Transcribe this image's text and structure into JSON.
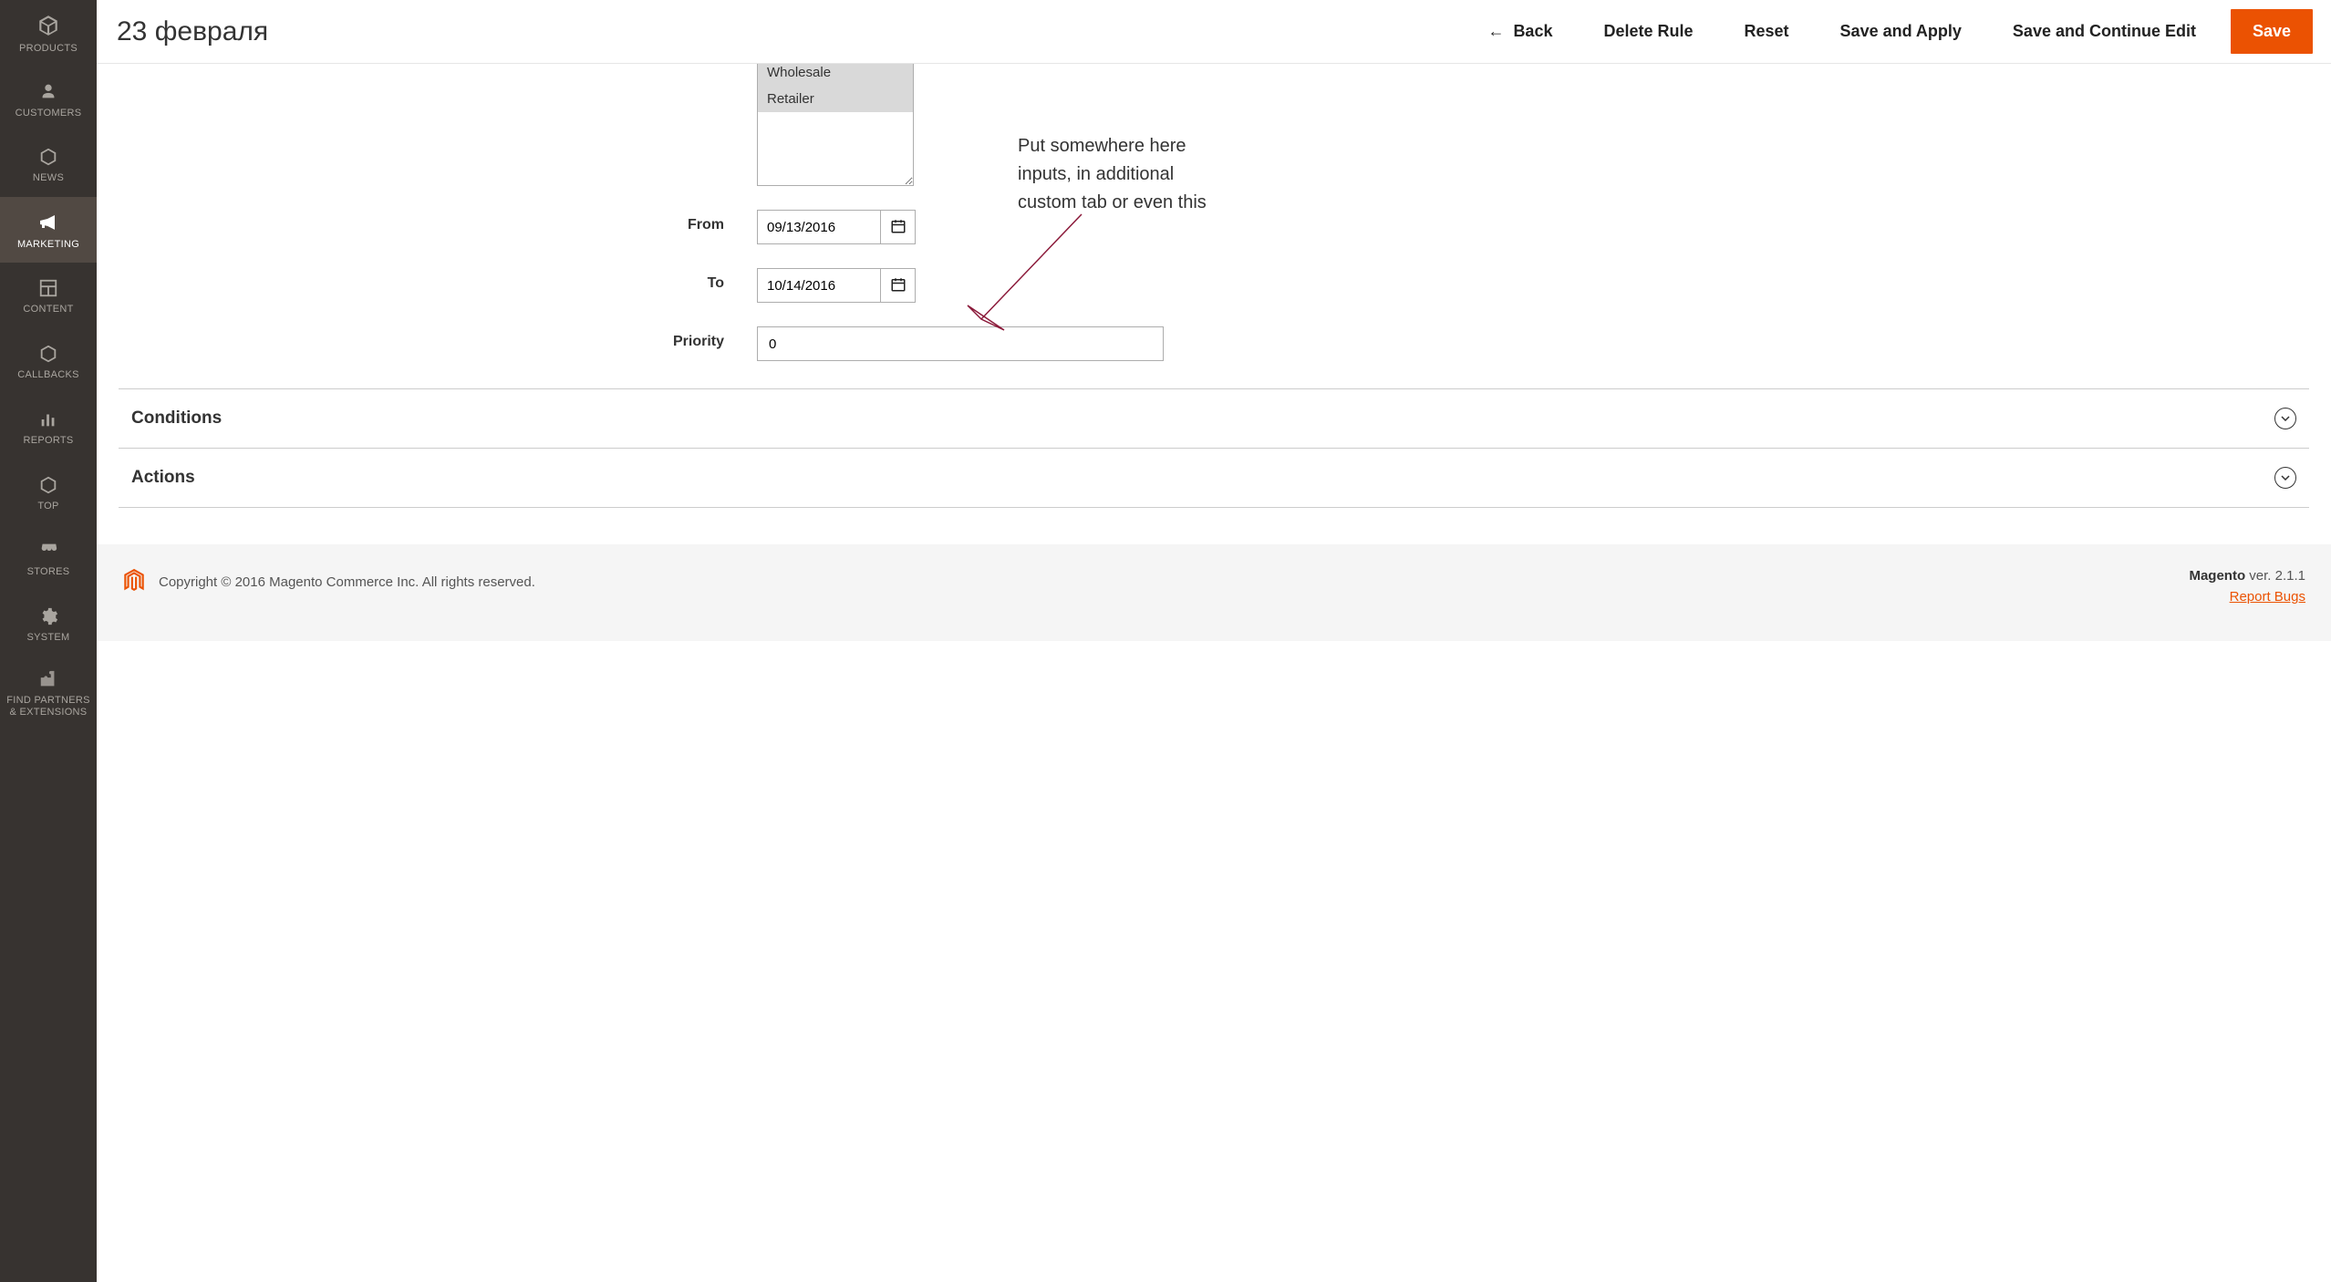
{
  "sidebar": {
    "items": [
      {
        "label": "PRODUCTS"
      },
      {
        "label": "CUSTOMERS"
      },
      {
        "label": "NEWS"
      },
      {
        "label": "MARKETING"
      },
      {
        "label": "CONTENT"
      },
      {
        "label": "CALLBACKS"
      },
      {
        "label": "REPORTS"
      },
      {
        "label": "TOP"
      },
      {
        "label": "STORES"
      },
      {
        "label": "SYSTEM"
      },
      {
        "label": "FIND PARTNERS\n& EXTENSIONS"
      }
    ]
  },
  "header": {
    "title": "23 февраля",
    "back_label": "Back",
    "delete_label": "Delete Rule",
    "reset_label": "Reset",
    "save_apply_label": "Save and Apply",
    "save_continue_label": "Save and Continue Edit",
    "save_label": "Save"
  },
  "form": {
    "customer_groups": {
      "options": [
        "Wholesale",
        "Retailer"
      ]
    },
    "from": {
      "label": "From",
      "value": "09/13/2016"
    },
    "to": {
      "label": "To",
      "value": "10/14/2016"
    },
    "priority": {
      "label": "Priority",
      "value": "0"
    }
  },
  "annotation": {
    "text": "Put somewhere here\ninputs, in additional\ncustom tab or even this"
  },
  "sections": {
    "conditions": "Conditions",
    "actions": "Actions"
  },
  "footer": {
    "copyright": "Copyright © 2016 Magento Commerce Inc. All rights reserved.",
    "brand": "Magento",
    "version": " ver. 2.1.1",
    "report": "Report Bugs"
  }
}
